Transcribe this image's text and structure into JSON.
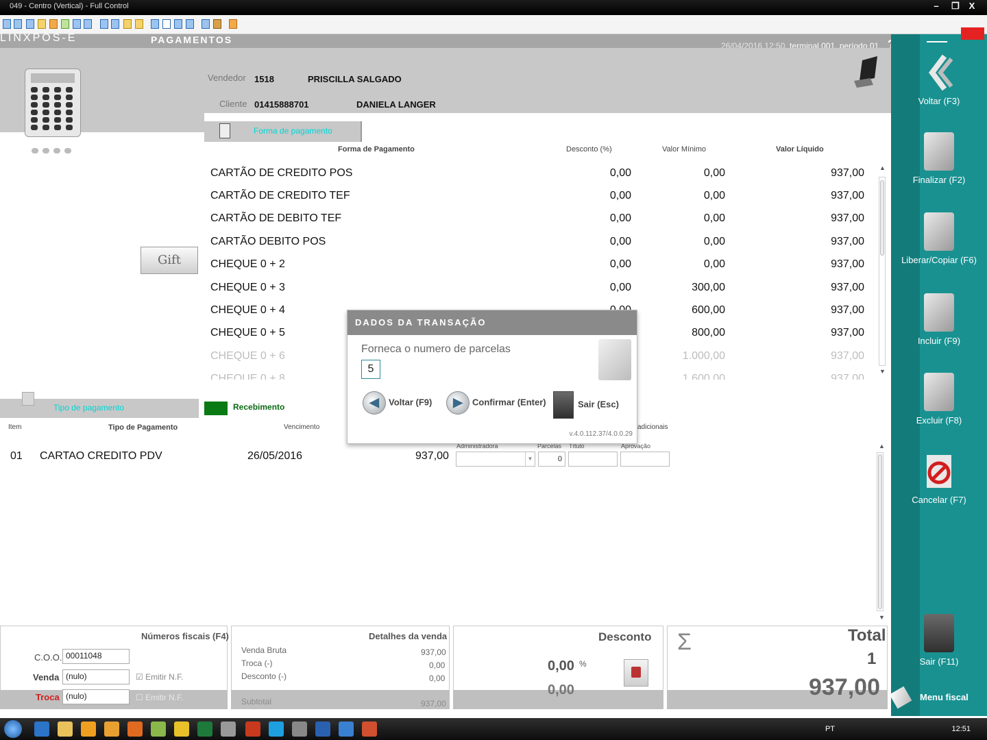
{
  "window": {
    "title": "049 - Centro (Vertical) - Full Control",
    "minimize": "–",
    "maximize": "❐",
    "close": "X"
  },
  "app": {
    "brand": "LINXPOS-E",
    "screen_title": "PAGAMENTOS",
    "datetime": "26/04/2016 12:50,",
    "terminal": "terminal 001, período 01.",
    "help": "?",
    "info": "ⓘ"
  },
  "header": {
    "vendedor_label": "Vendedor",
    "vendedor_code": "1518",
    "vendedor_name": "PRISCILLA SALGADO",
    "cliente_label": "Cliente",
    "cliente_code": "01415888701",
    "cliente_name": "DANIELA LANGER"
  },
  "forms_tab": {
    "label": "Forma de pagamento"
  },
  "payments_table": {
    "headers": {
      "forma": "Forma de Pagamento",
      "desconto": "Desconto (%)",
      "minimo": "Valor Mínimo",
      "liquido": "Valor Líquido"
    },
    "rows": [
      {
        "name": "CARTÃO DE CREDITO POS",
        "desc": "0,00",
        "min": "0,00",
        "liq": "937,00"
      },
      {
        "name": "CARTÃO DE CREDITO TEF",
        "desc": "0,00",
        "min": "0,00",
        "liq": "937,00"
      },
      {
        "name": "CARTÃO DE DEBITO TEF",
        "desc": "0,00",
        "min": "0,00",
        "liq": "937,00"
      },
      {
        "name": "CARTÃO DEBITO POS",
        "desc": "0,00",
        "min": "0,00",
        "liq": "937,00"
      },
      {
        "name": "CHEQUE 0 + 2",
        "desc": "0,00",
        "min": "0,00",
        "liq": "937,00"
      },
      {
        "name": "CHEQUE 0 + 3",
        "desc": "0,00",
        "min": "300,00",
        "liq": "937,00"
      },
      {
        "name": "CHEQUE 0 + 4",
        "desc": "0,00",
        "min": "600,00",
        "liq": "937,00"
      },
      {
        "name": "CHEQUE 0 + 5",
        "desc": "",
        "min": "800,00",
        "liq": "937,00"
      },
      {
        "name": "CHEQUE 0 + 6",
        "desc": "",
        "min": "1.000,00",
        "liq": "937,00"
      },
      {
        "name": "CHEQUE 0 + 8",
        "desc": "",
        "min": "1.600,00",
        "liq": "937,00"
      }
    ]
  },
  "gift_button": {
    "label": "Gift"
  },
  "dialog": {
    "title": "DADOS DA TRANSAÇÃO",
    "prompt": "Forneca o numero de parcelas",
    "value": "5",
    "back": "Voltar (F9)",
    "confirm": "Confirmar (Enter)",
    "exit": "Sair (Esc)",
    "version": "v.4.0.112.37/4.0.0.29"
  },
  "lower_tabs": {
    "tipo_label": "Tipo de pagamento",
    "recebimento_label": "Recebimento"
  },
  "lower_table": {
    "headers": {
      "item": "Item",
      "tipo": "Tipo de Pagamento",
      "venc": "Vencimento",
      "adicionais": "adicionais",
      "admin": "Administradora",
      "parcelas": "Parcelas",
      "titulo": "Título",
      "aprovacao": "Aprovação"
    },
    "rows": [
      {
        "item": "01",
        "tipo": "CARTAO CREDITO PDV",
        "venc": "26/05/2016",
        "valor": "937,00",
        "parcelas": "0"
      }
    ]
  },
  "fiscal": {
    "title": "Números fiscais (F4)",
    "coo_label": "C.O.O.",
    "coo_value": "00011048",
    "venda_label": "Venda",
    "venda_value": "(nulo)",
    "emitir_label": "Emitir N.F.",
    "troca_label": "Troca",
    "troca_value": "(nulo)",
    "emitir2_label": "Emitir N.F."
  },
  "sale_details": {
    "title": "Detalhes da venda",
    "venda_bruta_label": "Venda Bruta",
    "venda_bruta": "937,00",
    "troca_label": "Troca (-)",
    "troca": "0,00",
    "desconto_label": "Desconto (-)",
    "desconto": "0,00",
    "subtotal_label": "Subtotal",
    "subtotal": "937,00"
  },
  "discount": {
    "title": "Desconto",
    "percent_value": "0,00",
    "percent_sign": "%",
    "value": "0,00"
  },
  "total": {
    "sigma": "Σ",
    "title": "Total",
    "items": "1",
    "value": "937,00"
  },
  "sidebar": {
    "buttons": [
      {
        "label": "Voltar (F3)"
      },
      {
        "label": "Finalizar (F2)"
      },
      {
        "label": "Liberar/Copiar (F6)"
      },
      {
        "label": "Incluir (F9)"
      },
      {
        "label": "Excluir (F8)"
      },
      {
        "label": "Cancelar (F7)"
      },
      {
        "label": "Sair (F11)"
      }
    ],
    "menu_fiscal": "Menu fiscal"
  },
  "taskbar": {
    "lang": "PT",
    "time": "12:51"
  },
  "colors": {
    "sidebar": "#199191",
    "accent_green": "#0a7a14",
    "tab_text": "#00d6d6"
  }
}
